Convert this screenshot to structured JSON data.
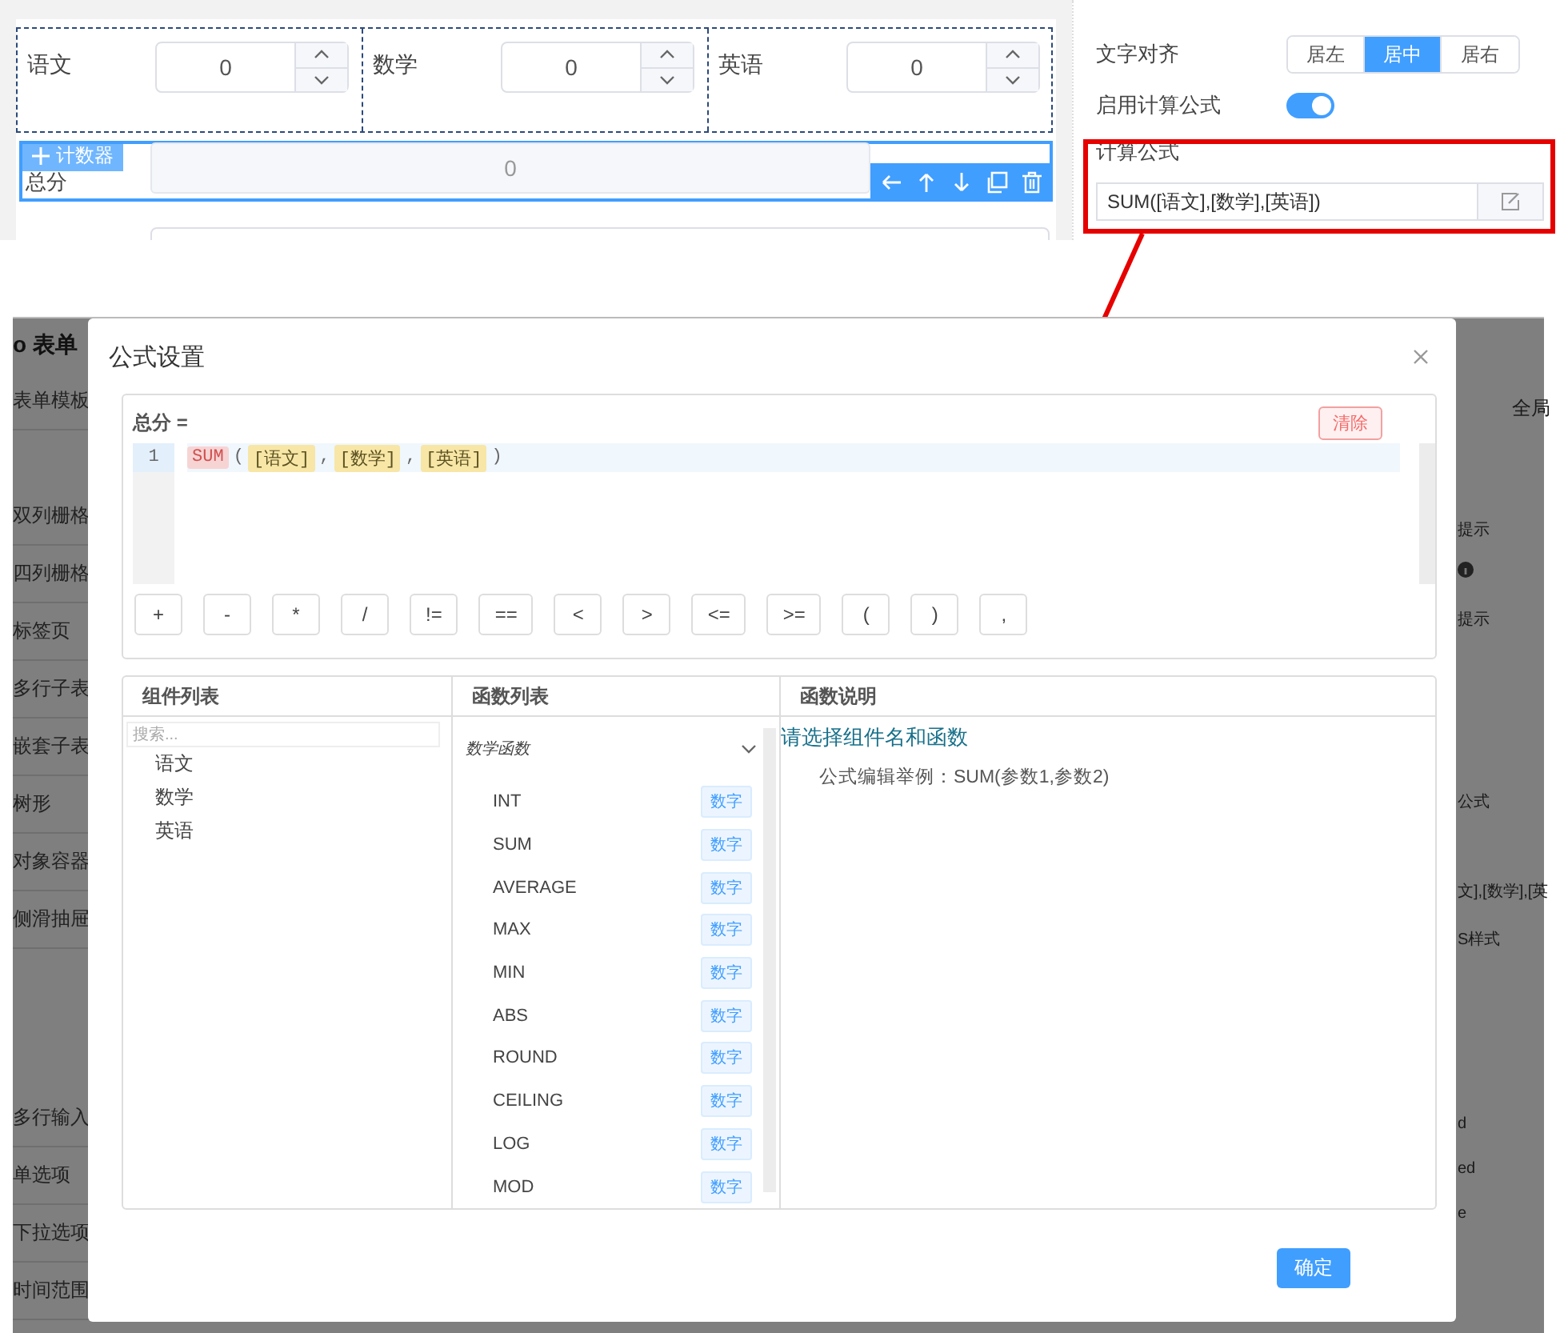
{
  "form_canvas": {
    "score_fields": [
      {
        "label": "语文",
        "value": "0"
      },
      {
        "label": "数学",
        "value": "0"
      },
      {
        "label": "英语",
        "value": "0"
      }
    ],
    "total": {
      "label": "总分",
      "tag": "计数器",
      "value": "0",
      "selected": true
    }
  },
  "properties": {
    "align": {
      "label": "文字对齐",
      "options": [
        {
          "label": "居左",
          "selected": false
        },
        {
          "label": "居中",
          "selected": true
        },
        {
          "label": "居右",
          "selected": false
        }
      ]
    },
    "formula_toggle": {
      "label": "启用计算公式",
      "on": true
    },
    "formula": {
      "label": "计算公式",
      "value": "SUM([语文],[数学],[英语])"
    }
  },
  "background_app": {
    "title": "o 表单",
    "sidebar_items": [
      "表单模板",
      "双列栅格",
      "四列栅格",
      "标签页",
      "多行子表",
      "嵌套子表",
      "树形",
      "对象容器",
      "侧滑抽屉",
      "多行输入",
      "单选项",
      "下拉选项",
      "时间范围"
    ],
    "side_fragments": [
      {
        "kind": "text",
        "text": "全局"
      },
      {
        "kind": "text",
        "text": "提示"
      },
      {
        "kind": "info"
      },
      {
        "kind": "text",
        "text": "提示"
      },
      {
        "kind": "text",
        "text": "公式"
      },
      {
        "kind": "text",
        "text": "文],[数学],[英"
      },
      {
        "kind": "text",
        "text": "S样式"
      },
      {
        "kind": "text",
        "text": "d"
      },
      {
        "kind": "text",
        "text": "ed"
      },
      {
        "kind": "text",
        "text": "e"
      }
    ]
  },
  "dialog": {
    "title": "公式设置",
    "target": "总分 =",
    "clear": "清除",
    "code_lines": [
      {
        "number": "1",
        "tokens": [
          {
            "kind": "function",
            "text": "SUM"
          },
          {
            "kind": "punct",
            "text": "("
          },
          {
            "kind": "field",
            "text": "[语文]"
          },
          {
            "kind": "punct",
            "text": ","
          },
          {
            "kind": "field",
            "text": "[数学]"
          },
          {
            "kind": "punct",
            "text": ","
          },
          {
            "kind": "field",
            "text": "[英语]"
          },
          {
            "kind": "punct",
            "text": ")"
          }
        ]
      }
    ],
    "operators": [
      "+",
      "-",
      "*",
      "/",
      "!=",
      "==",
      "<",
      ">",
      "<=",
      ">=",
      "(",
      ")",
      ","
    ],
    "components": {
      "title": "组件列表",
      "search_placeholder": "搜索...",
      "items": [
        "语文",
        "数学",
        "英语"
      ]
    },
    "functions": {
      "title": "函数列表",
      "group": "数学函数",
      "expanded": true,
      "items": [
        {
          "name": "INT",
          "type": "数字"
        },
        {
          "name": "SUM",
          "type": "数字"
        },
        {
          "name": "AVERAGE",
          "type": "数字"
        },
        {
          "name": "MAX",
          "type": "数字"
        },
        {
          "name": "MIN",
          "type": "数字"
        },
        {
          "name": "ABS",
          "type": "数字"
        },
        {
          "name": "ROUND",
          "type": "数字"
        },
        {
          "name": "CEILING",
          "type": "数字"
        },
        {
          "name": "LOG",
          "type": "数字"
        },
        {
          "name": "MOD",
          "type": "数字"
        }
      ]
    },
    "help": {
      "title": "函数说明",
      "prompt": "请选择组件名和函数",
      "example": "公式编辑举例：SUM(参数1,参数2)"
    },
    "confirm": "确定"
  }
}
